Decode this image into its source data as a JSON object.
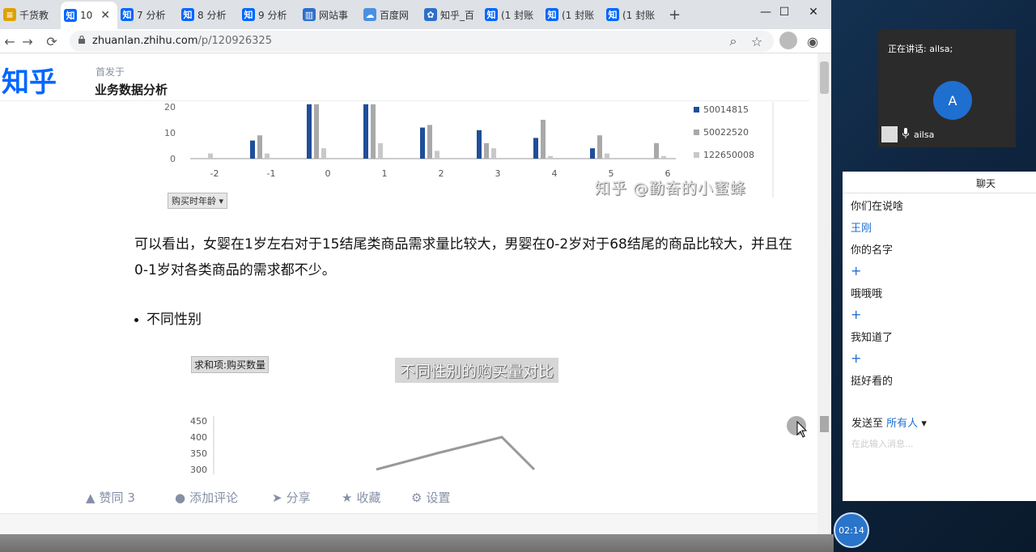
{
  "tabs": [
    {
      "label": "千货教",
      "icon": "document-icon",
      "active": false
    },
    {
      "label": "10",
      "icon": "zhihu-icon",
      "active": true
    },
    {
      "label": "7 分析",
      "icon": "zhihu-icon",
      "active": false
    },
    {
      "label": "8 分析",
      "icon": "zhihu-icon",
      "active": false
    },
    {
      "label": "9 分析",
      "icon": "zhihu-icon",
      "active": false
    },
    {
      "label": "网站事",
      "icon": "chart-icon",
      "active": false
    },
    {
      "label": "百度网",
      "icon": "cloud-icon",
      "active": false
    },
    {
      "label": "知乎_百",
      "icon": "paw-icon",
      "active": false
    },
    {
      "label": "(1 封账",
      "icon": "zhihu-icon",
      "active": false
    },
    {
      "label": "(1 封账",
      "icon": "zhihu-icon",
      "active": false
    },
    {
      "label": "(1 封账",
      "icon": "zhihu-icon",
      "active": false
    }
  ],
  "address": {
    "host": "zhuanlan.zhihu.com",
    "path": "/p/120926325"
  },
  "header": {
    "logo": "知乎",
    "published_in": "首发于",
    "column": "业务数据分析"
  },
  "chart_data": [
    {
      "type": "bar",
      "categories": [
        "-2",
        "-1",
        "0",
        "1",
        "2",
        "3",
        "4",
        "5",
        "6"
      ],
      "series": [
        {
          "name": "50014815",
          "color": "#1f4e9a",
          "values": [
            0,
            7,
            21,
            21,
            12,
            11,
            8,
            4,
            0
          ]
        },
        {
          "name": "50022520",
          "color": "#a9a9a9",
          "values": [
            0,
            9,
            21,
            21,
            13,
            6,
            15,
            9,
            6
          ]
        },
        {
          "name": "122650008",
          "color": "#c8c8c8",
          "values": [
            2,
            2,
            4,
            6,
            3,
            4,
            1,
            2,
            1
          ]
        }
      ],
      "yticks": [
        "0",
        "10",
        "20"
      ],
      "ylim": [
        0,
        20
      ],
      "legend_position": "right"
    },
    {
      "type": "line",
      "title": "不同性别的购买量对比",
      "yticks": [
        "450",
        "400",
        "350",
        "300"
      ],
      "series": [
        {
          "values": [
            300,
            350,
            400,
            300
          ]
        }
      ]
    }
  ],
  "chart_tag": "购买时年龄",
  "watermark": "知乎 @勤奋的小蜜蜂",
  "paragraph": "可以看出，女婴在1岁左右对于15结尾类商品需求量比较大，男婴在0-2岁对于68结尾的商品比较大，并且在0-1岁对各类商品的需求都不少。",
  "bullet": "不同性别",
  "pivot_label": "求和项:购买数量",
  "actions": {
    "like": "赞同 3",
    "comment": "添加评论",
    "share": "分享",
    "favorite": "收藏",
    "settings": "设置"
  },
  "meeting": {
    "speaking": "正在讲话: ailsa;",
    "avatar_letter": "A",
    "participant": "ailsa"
  },
  "chat": {
    "title": "聊天",
    "messages": [
      {
        "text": "你们在说啥",
        "type": "text"
      },
      {
        "text": "王刚",
        "type": "sender"
      },
      {
        "text": "你的名字",
        "type": "text"
      },
      {
        "text": "+",
        "type": "plus"
      },
      {
        "text": "哦哦哦",
        "type": "text"
      },
      {
        "text": "+",
        "type": "plus"
      },
      {
        "text": "我知道了",
        "type": "text"
      },
      {
        "text": "+",
        "type": "plus"
      },
      {
        "text": "挺好看的",
        "type": "text"
      }
    ],
    "send_to_label": "发送至",
    "send_to_target": "所有人",
    "input_placeholder": "在此输入消息..."
  },
  "clock": "02:14"
}
